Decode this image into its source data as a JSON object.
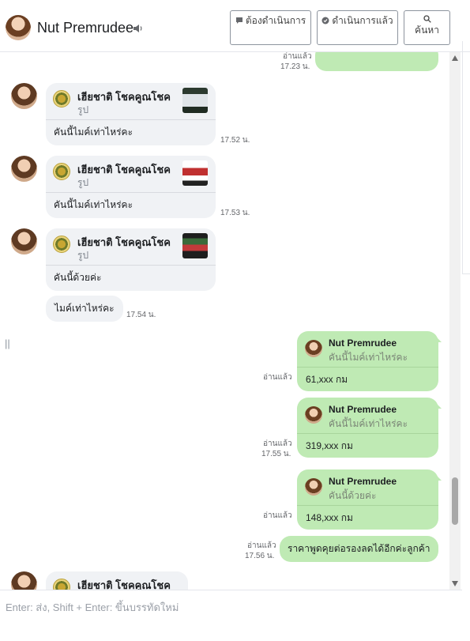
{
  "header": {
    "contact_name": "Nut Premrudee",
    "buttons": [
      {
        "label": "ต้องดำเนินการ",
        "icon": "chat-bubble-icon"
      },
      {
        "label": "ดำเนินการแล้ว",
        "icon": "chat-check-icon"
      },
      {
        "label": "ค้นหา",
        "icon": "search-icon"
      }
    ]
  },
  "messages": {
    "top_partial": {
      "status": "อ่านแล้ว",
      "time": "17.23 น."
    },
    "cards": [
      {
        "title": "เฮียชาติ โชคคูณโชค",
        "subtitle": "รูป",
        "text": "คันนี้ไมค์เท่าไหร่คะ",
        "time": "17.52 น."
      },
      {
        "title": "เฮียชาติ โชคคูณโชค",
        "subtitle": "รูป",
        "text": "คันนี้ไมค์เท่าไหร่คะ",
        "time": "17.53 น."
      },
      {
        "title": "เฮียชาติ โชคคูณโชค",
        "subtitle": "รูป",
        "text": "คันนี้ด้วยค่ะ",
        "time": ""
      }
    ],
    "plain_incoming": {
      "text": "ไมค์เท่าไหร่คะ",
      "time": "17.54 น."
    },
    "replies": [
      {
        "name": "Nut Premrudee",
        "quote": "คันนี้ไมค์เท่าไหร่คะ",
        "text": "61,xxx กม",
        "status": "อ่านแล้ว",
        "time": ""
      },
      {
        "name": "Nut Premrudee",
        "quote": "คันนี้ไมค์เท่าไหร่คะ",
        "text": "319,xxx  กม",
        "status": "อ่านแล้ว",
        "time": "17.55 น."
      },
      {
        "name": "Nut Premrudee",
        "quote": "คันนี้ด้วยค่ะ",
        "text": "148,xxx กม",
        "status": "อ่านแล้ว",
        "time": ""
      }
    ],
    "last_outgoing": {
      "text": "ราคาพูดคุยต่อรองลดได้อีกค่ะลูกค้า",
      "status": "อ่านแล้ว",
      "time": "17.56 น."
    },
    "bottom_card": {
      "title": "เฮียชาติ โชคคูณโชค"
    }
  },
  "composer": {
    "placeholder": "Enter: ส่ง, Shift + Enter: ขึ้นบรรทัดใหม่"
  },
  "colors": {
    "outgoing_bubble": "#bfeab4",
    "incoming_bubble": "#f0f2f5"
  }
}
